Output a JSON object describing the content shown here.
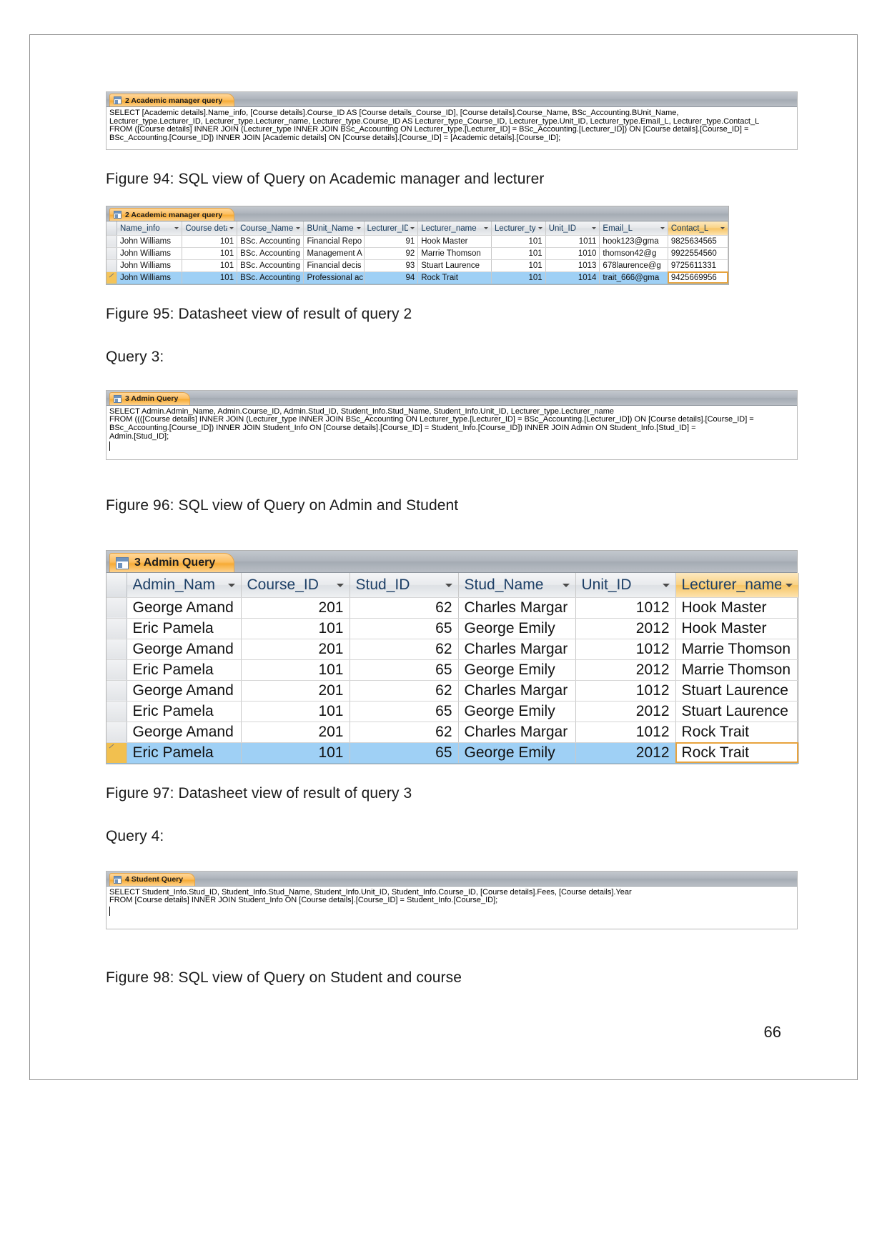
{
  "document": {
    "page_number": "66"
  },
  "fig94_sql": {
    "tab_label": "2 Academic manager query",
    "lines": [
      "SELECT [Academic details].Name_info, [Course details].Course_ID AS [Course details_Course_ID], [Course details].Course_Name, BSc_Accounting.BUnit_Name,",
      "Lecturer_type.Lecturer_ID, Lecturer_type.Lecturer_name, Lecturer_type.Course_ID AS Lecturer_type_Course_ID, Lecturer_type.Unit_ID, Lecturer_type.Email_L, Lecturer_type.Contact_L",
      "FROM ([Course details] INNER JOIN (Lecturer_type INNER JOIN BSc_Accounting ON Lecturer_type.[Lecturer_ID] = BSc_Accounting.[Lecturer_ID]) ON [Course details].[Course_ID] =",
      "BSc_Accounting.[Course_ID]) INNER JOIN [Academic details] ON [Course details].[Course_ID] = [Academic details].[Course_ID];"
    ]
  },
  "caption94": "Figure 94: SQL view of Query on Academic manager and lecturer",
  "fig95_datasheet": {
    "tab_label": "2 Academic manager query",
    "columns": [
      "Name_info",
      "Course deta",
      "Course_Name",
      "BUnit_Name",
      "Lecturer_ID",
      "Lecturer_name",
      "Lecturer_typ",
      "Unit_ID",
      "Email_L",
      "Contact_L"
    ],
    "rows": [
      [
        "John Williams",
        "101",
        "BSc. Accounting",
        "Financial Repo",
        "91",
        "Hook Master",
        "101",
        "1011",
        "hook123@gma",
        "9825634565"
      ],
      [
        "John Williams",
        "101",
        "BSc. Accounting",
        "Management A",
        "92",
        "Marrie Thomson",
        "101",
        "1010",
        "thomson42@g",
        "9922554560"
      ],
      [
        "John Williams",
        "101",
        "BSc. Accounting",
        "Financial decis",
        "93",
        "Stuart Laurence",
        "101",
        "1013",
        "678laurence@g",
        "9725611331"
      ],
      [
        "John Williams",
        "101",
        "BSc. Accounting",
        "Professional ac",
        "94",
        "Rock Trait",
        "101",
        "1014",
        "trait_666@gma",
        "9425669956"
      ]
    ],
    "selected_row_index": 3,
    "focused_column_index": 9
  },
  "caption95": "Figure 95: Datasheet view of result of query 2",
  "query3_label": "Query 3:",
  "fig96_sql": {
    "tab_label": "3 Admin Query",
    "lines": [
      "SELECT Admin.Admin_Name, Admin.Course_ID, Admin.Stud_ID, Student_Info.Stud_Name, Student_Info.Unit_ID, Lecturer_type.Lecturer_name",
      "FROM ((([Course details] INNER JOIN (Lecturer_type INNER JOIN BSc_Accounting ON Lecturer_type.[Lecturer_ID] = BSc_Accounting.[Lecturer_ID]) ON [Course details].[Course_ID] =",
      "BSc_Accounting.[Course_ID]) INNER JOIN Student_Info ON [Course details].[Course_ID] = Student_Info.[Course_ID]) INNER JOIN Admin ON Student_Info.[Stud_ID] =",
      "Admin.[Stud_ID];"
    ]
  },
  "caption96": "Figure 96: SQL view of Query on Admin and Student",
  "fig97_datasheet": {
    "tab_label": "3 Admin Query",
    "columns": [
      "Admin_Nam",
      "Course_ID",
      "Stud_ID",
      "Stud_Name",
      "Unit_ID",
      "Lecturer_name"
    ],
    "rows": [
      [
        "George Amand",
        "201",
        "62",
        "Charles Margar",
        "1012",
        "Hook Master"
      ],
      [
        "Eric Pamela",
        "101",
        "65",
        "George Emily",
        "2012",
        "Hook Master"
      ],
      [
        "George Amand",
        "201",
        "62",
        "Charles Margar",
        "1012",
        "Marrie Thomson"
      ],
      [
        "Eric Pamela",
        "101",
        "65",
        "George Emily",
        "2012",
        "Marrie Thomson"
      ],
      [
        "George Amand",
        "201",
        "62",
        "Charles Margar",
        "1012",
        "Stuart Laurence"
      ],
      [
        "Eric Pamela",
        "101",
        "65",
        "George Emily",
        "2012",
        "Stuart Laurence"
      ],
      [
        "George Amand",
        "201",
        "62",
        "Charles Margar",
        "1012",
        "Rock Trait"
      ],
      [
        "Eric Pamela",
        "101",
        "65",
        "George Emily",
        "2012",
        "Rock Trait"
      ]
    ],
    "selected_row_index": 7,
    "focused_column_index": 5
  },
  "caption97": "Figure 97: Datasheet view of result of query 3",
  "query4_label": "Query 4:",
  "fig98_sql": {
    "tab_label": "4 Student Query",
    "lines": [
      "SELECT Student_Info.Stud_ID, Student_Info.Stud_Name, Student_Info.Unit_ID, Student_Info.Course_ID, [Course details].Fees, [Course details].Year",
      "FROM [Course details] INNER JOIN Student_Info ON [Course details].[Course_ID] = Student_Info.[Course_ID];"
    ]
  },
  "caption98": "Figure 98: SQL view of Query on Student and course"
}
